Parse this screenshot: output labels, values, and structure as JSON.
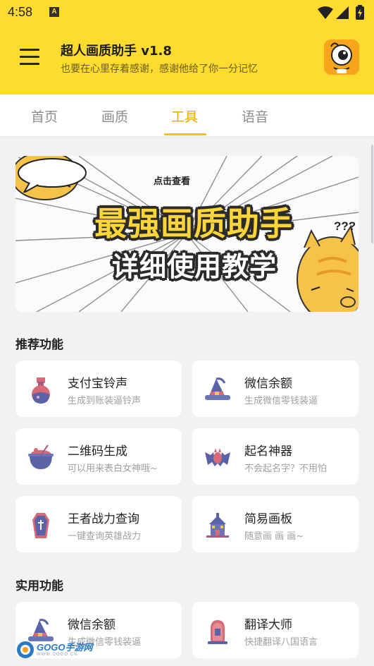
{
  "status_bar": {
    "time": "4:58",
    "notification_icon": "text-a-icon",
    "system_icons": [
      "wifi-icon",
      "signal-icon",
      "battery-charging-icon"
    ]
  },
  "app_bar": {
    "title": "超人画质助手 v1.8",
    "subtitle": "也要在心里存着感谢，感谢他给了你一分记忆",
    "menu_icon": "hamburger-menu-icon",
    "avatar_icon": "monster-avatar-icon"
  },
  "tabs": [
    {
      "label": "首页",
      "active": false
    },
    {
      "label": "画质",
      "active": false
    },
    {
      "label": "工具",
      "active": true
    },
    {
      "label": "语音",
      "active": false
    }
  ],
  "banner": {
    "bubble_text": "点击查看",
    "line1": "最强画质助手",
    "line2": "详细使用教学",
    "question_marks": "???"
  },
  "sections": {
    "recommended": {
      "title": "推荐功能",
      "items": [
        {
          "title": "支付宝铃声",
          "desc": "生成到账装逼铃声",
          "icon": "potion-bottle-icon"
        },
        {
          "title": "微信余额",
          "desc": "生成微信零钱装逼",
          "icon": "wizard-hat-icon"
        },
        {
          "title": "二维码生成",
          "desc": "可以用来表白女神哦~",
          "icon": "cauldron-icon"
        },
        {
          "title": "起名神器",
          "desc": "不会起名字？不用怕",
          "icon": "bat-icon"
        },
        {
          "title": "王者战力查询",
          "desc": "一键查询英雄战力",
          "icon": "coffin-icon"
        },
        {
          "title": "简易画板",
          "desc": "随意画 画 画~",
          "icon": "haunted-house-icon"
        }
      ]
    },
    "practical": {
      "title": "实用功能",
      "items": [
        {
          "title": "微信余额",
          "desc": "生成微信零钱装逼",
          "icon": "wizard-hat-icon"
        },
        {
          "title": "翻译大师",
          "desc": "快捷翻译八国语言",
          "icon": "tombstone-icon"
        }
      ]
    }
  },
  "watermark": {
    "brand": "GOGO手游网",
    "url": "WWW.GOGO.CN"
  },
  "colors": {
    "accent_yellow": "#fedb2f",
    "tab_active": "#e9a800",
    "background": "#f2f2f4"
  }
}
